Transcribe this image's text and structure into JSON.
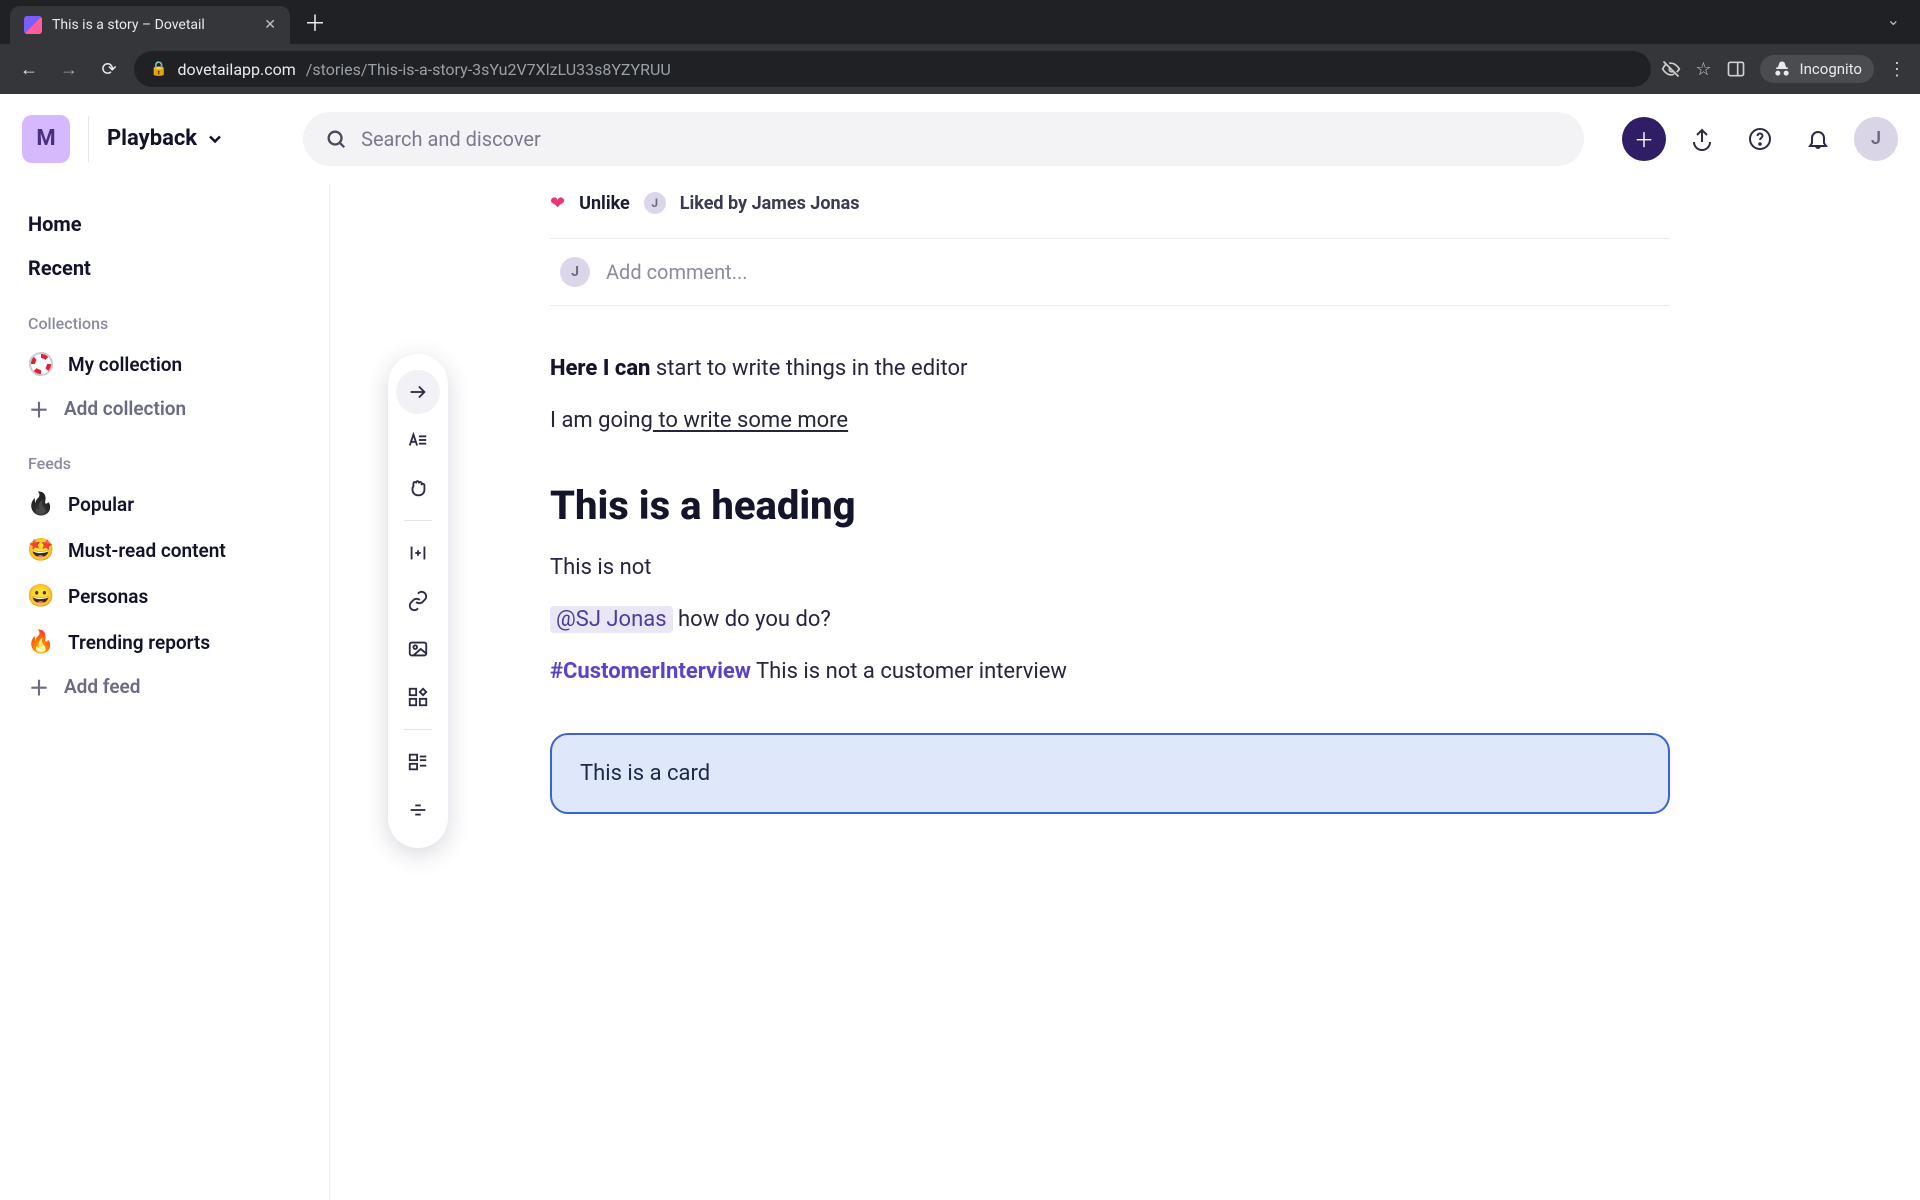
{
  "browser": {
    "tab_title": "This is a story – Dovetail",
    "url_host": "dovetailapp.com",
    "url_path": "/stories/This-is-a-story-3sYu2V7XlzLU33s8YZYRUU",
    "incognito_label": "Incognito"
  },
  "header": {
    "workspace_initial": "M",
    "workspace_name": "Playback",
    "search_placeholder": "Search and discover",
    "user_initial": "J"
  },
  "sidebar": {
    "nav": {
      "home": "Home",
      "recent": "Recent"
    },
    "collections_label": "Collections",
    "collections": [
      {
        "icon": "buoy",
        "label": "My collection"
      }
    ],
    "add_collection": "Add collection",
    "feeds_label": "Feeds",
    "feeds": [
      {
        "emoji": "🔥",
        "dark": true,
        "label": "Popular"
      },
      {
        "emoji": "🤩",
        "label": "Must-read content"
      },
      {
        "emoji": "😀",
        "label": "Personas"
      },
      {
        "emoji": "🔥",
        "label": "Trending reports"
      }
    ],
    "add_feed": "Add feed"
  },
  "story": {
    "unlike_label": "Unlike",
    "liked_by_text": "Liked by James Jonas",
    "liker_initial": "J",
    "comment_placeholder": "Add comment...",
    "comment_avatar": "J",
    "line1_bold": "Here I can",
    "line1_rest": " start to write things in the editor",
    "line2_plain": "I am going",
    "line2_under": " to write some more",
    "heading": "This is a heading",
    "line3": "This is not",
    "mention": "@SJ Jonas",
    "mention_rest": " how do you do?",
    "hashtag": "#CustomerInterview",
    "hashtag_rest": " This is not a customer interview",
    "card_text": "This is a card"
  }
}
